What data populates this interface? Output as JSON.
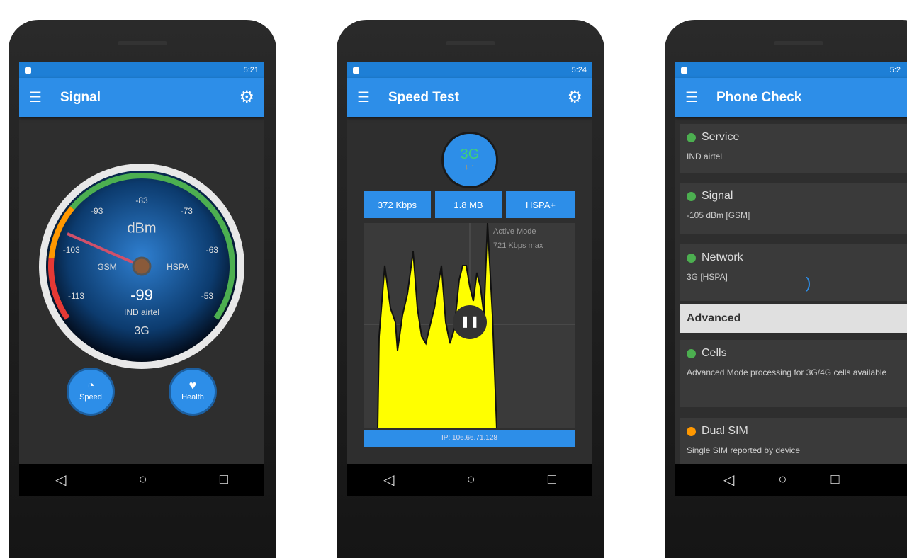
{
  "colors": {
    "accent": "#2d8ee8",
    "good": "#4caf50",
    "warn": "#ff9800",
    "bad": "#e53935",
    "chart": "#ffff00"
  },
  "nav": {
    "back": "◁",
    "home": "○",
    "recent": "□"
  },
  "signal": {
    "time": "5:21",
    "title": "Signal",
    "unit": "dBm",
    "ticks": [
      "-113",
      "-103",
      "-93",
      "-83",
      "-73",
      "-63",
      "-53"
    ],
    "left_mode": "GSM",
    "right_mode": "HSPA",
    "value": "-99",
    "operator": "IND airtel",
    "network": "3G",
    "buttons": [
      {
        "label": "Speed",
        "icon": "speed-icon"
      },
      {
        "label": "Health",
        "icon": "health-icon"
      }
    ]
  },
  "speed": {
    "time": "5:24",
    "title": "Speed Test",
    "badge": "3G",
    "badge_sub": "↓ ↑",
    "stats": [
      "372 Kbps",
      "1.8 MB",
      "HSPA+"
    ],
    "overlay": [
      "Active Mode",
      "721 Kbps max"
    ],
    "ip": "IP: 106.66.71.128"
  },
  "check": {
    "title": "Phone Check",
    "time": "5:2",
    "items": [
      {
        "label": "Service",
        "value": "IND airtel",
        "status": "good"
      },
      {
        "label": "Signal",
        "value": "-105 dBm [GSM]",
        "status": "good"
      },
      {
        "label": "Network",
        "value": "3G [HSPA]",
        "status": "good"
      }
    ],
    "section": "Advanced",
    "advanced": [
      {
        "label": "Cells",
        "value": "Advanced Mode processing for 3G/4G cells available",
        "status": "good"
      },
      {
        "label": "Dual SIM",
        "value": "Single SIM reported by device",
        "status": "warn"
      }
    ]
  }
}
